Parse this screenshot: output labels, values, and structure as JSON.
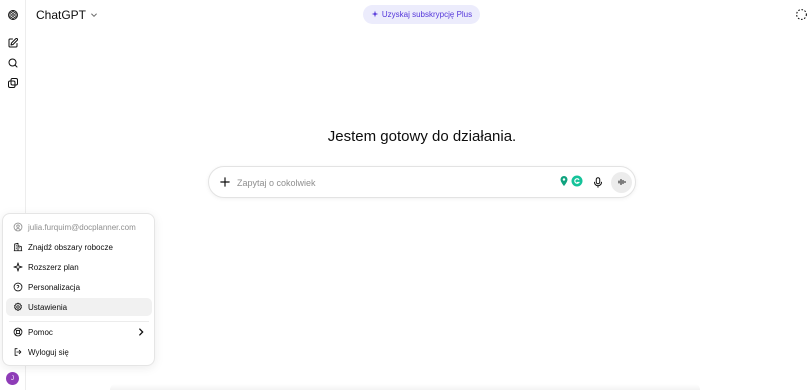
{
  "header": {
    "model_name": "ChatGPT",
    "upgrade_label": "Uzyskaj subskrypcję Plus",
    "icons": [
      "openai-logo-icon",
      "chevron-down-icon",
      "sparkle-icon",
      "temporary-chat-icon"
    ]
  },
  "rail": {
    "icons": [
      "new-chat-icon",
      "search-icon",
      "library-icon"
    ]
  },
  "main": {
    "title": "Jestem gotowy do działania."
  },
  "composer": {
    "placeholder": "Zapytaj o cokolwiek",
    "value": "",
    "icons": [
      "plus-icon",
      "extension-icon",
      "grammarly-icon",
      "microphone-icon",
      "voice-mode-icon"
    ]
  },
  "account_menu": {
    "email": "julia.furquim@docplanner.com",
    "items": [
      {
        "label": "Znajdź obszary robocze",
        "icon": "building-icon"
      },
      {
        "label": "Rozszerz plan",
        "icon": "sparkle-icon"
      },
      {
        "label": "Personalizacja",
        "icon": "personalization-icon"
      },
      {
        "label": "Ustawienia",
        "icon": "gear-icon",
        "active": true
      },
      {
        "label": "Pomoc",
        "icon": "lifebuoy-icon",
        "has_submenu": true
      },
      {
        "label": "Wyloguj się",
        "icon": "logout-icon"
      }
    ]
  },
  "avatar": {
    "initial": "J",
    "color": "#8e3cb7"
  },
  "colors": {
    "accent": "#5436da",
    "upgrade_bg": "#ececfc",
    "active_row": "#f1f1f1",
    "muted_text": "#8f8f8f",
    "grammarly": "#15c39a"
  }
}
